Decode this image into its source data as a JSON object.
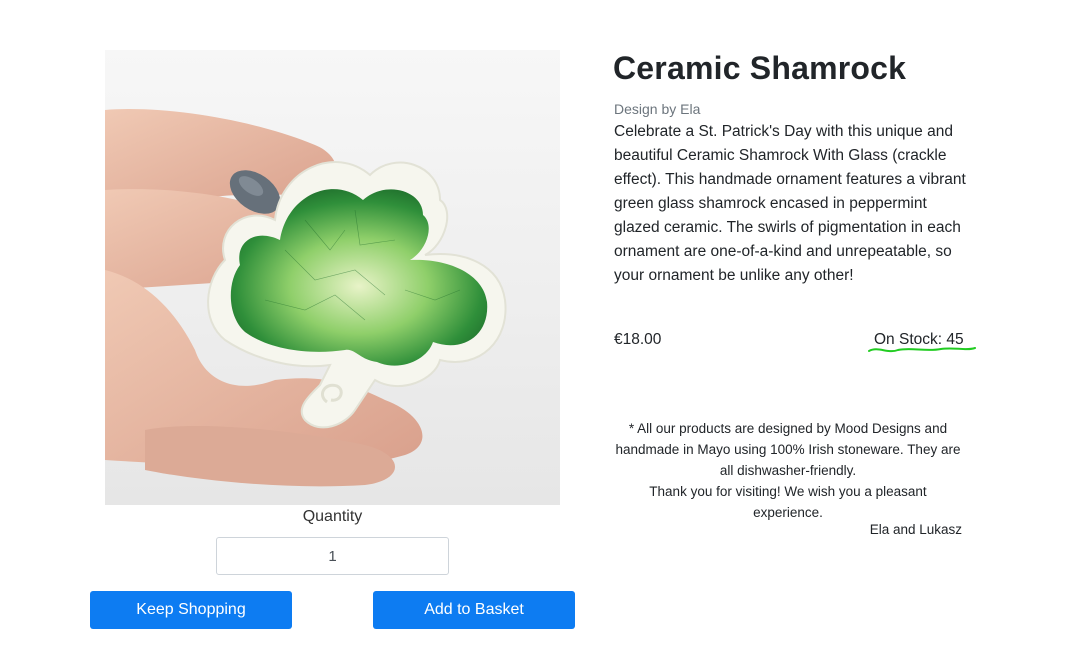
{
  "product": {
    "title": "Ceramic Shamrock",
    "designer": "Design by Ela",
    "description": "Celebrate a St. Patrick's Day with this unique and beautiful Ceramic Shamrock With Glass (crackle effect). This handmade ornament features a vibrant green glass shamrock encased in peppermint glazed ceramic. The swirls of pigmentation in each ornament are one-of-a-kind and unrepeatable, so your ornament be unlike any other!",
    "price": "€18.00",
    "stock": "On Stock: 45",
    "image_description": "hand holding a green glass ceramic shamrock"
  },
  "quantity": {
    "label": "Quantity",
    "value": "1"
  },
  "buttons": {
    "keep_shopping": "Keep Shopping",
    "add_to_basket": "Add to Basket"
  },
  "notice": {
    "line1": "* All our products are designed by Mood Designs and handmade in Mayo using 100% Irish stoneware. They are all dishwasher-friendly.",
    "line2": "Thank you for visiting! We wish you a pleasant experience.",
    "signature": "Ela and Lukasz"
  },
  "colors": {
    "button": "#0d7cf2",
    "underline": "#22cc22",
    "shamrock_green": "#3a9a3a"
  }
}
